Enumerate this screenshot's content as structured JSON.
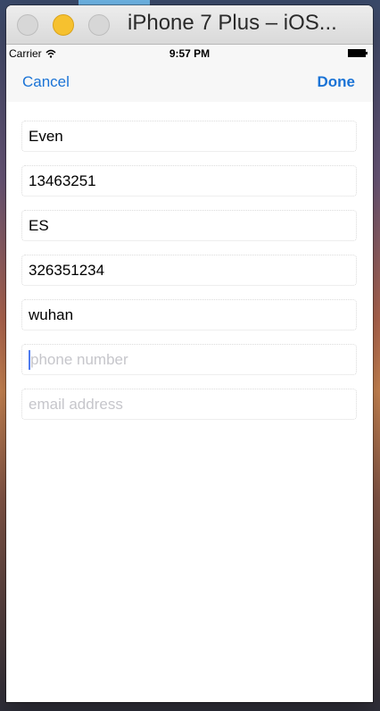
{
  "window": {
    "title": "iPhone 7 Plus – iOS..."
  },
  "status_bar": {
    "carrier": "Carrier",
    "time": "9:57 PM",
    "icons": [
      "wifi-icon",
      "battery-icon"
    ]
  },
  "nav": {
    "cancel_label": "Cancel",
    "done_label": "Done"
  },
  "form": {
    "fields": [
      {
        "value": "Even",
        "placeholder": ""
      },
      {
        "value": "13463251",
        "placeholder": ""
      },
      {
        "value": "ES",
        "placeholder": ""
      },
      {
        "value": "326351234",
        "placeholder": ""
      },
      {
        "value": "wuhan",
        "placeholder": ""
      },
      {
        "value": "",
        "placeholder": "phone number"
      },
      {
        "value": "",
        "placeholder": "email address"
      }
    ]
  },
  "colors": {
    "accent": "#1a73d6",
    "placeholder": "#c6c6cb",
    "nav_background": "#f7f7f7"
  }
}
